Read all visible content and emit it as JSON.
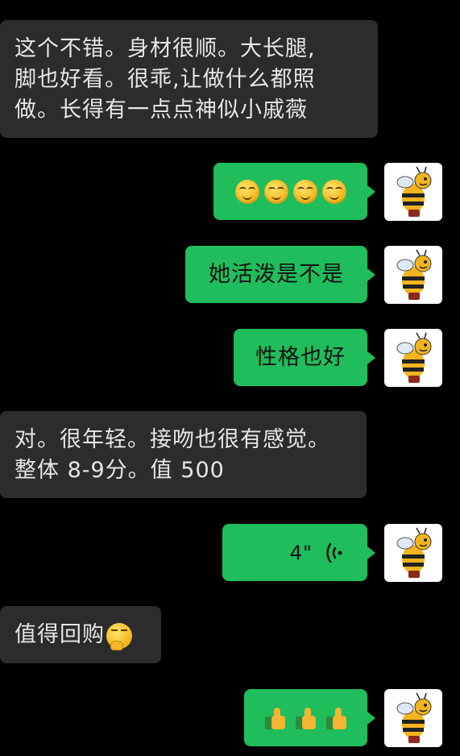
{
  "colors": {
    "background": "#000000",
    "incoming_bubble": "#2c2c2c",
    "outgoing_bubble": "#1fbd5b",
    "incoming_text": "#e6e6e6"
  },
  "messages": [
    {
      "side": "incoming",
      "lines": [
        "这个不错。身材很顺。大长腿,",
        "脚也好看。很乖,让做什么都照",
        "做。长得有一点点神似小戚薇"
      ]
    },
    {
      "side": "outgoing",
      "type": "emoji",
      "emojis": [
        "smirk-face-emoji",
        "smirk-face-emoji",
        "smirk-face-emoji",
        "smirk-face-emoji"
      ]
    },
    {
      "side": "outgoing",
      "text": "她活泼是不是"
    },
    {
      "side": "outgoing",
      "text": "性格也好"
    },
    {
      "side": "incoming",
      "lines": [
        "对。很年轻。接吻也很有感觉。",
        "整体 8-9分。值 500"
      ]
    },
    {
      "side": "outgoing",
      "type": "voice",
      "duration": "4\""
    },
    {
      "side": "incoming",
      "text": "值得回购",
      "trailing_emoji": "thinking-face-emoji"
    },
    {
      "side": "outgoing",
      "type": "emoji",
      "emojis": [
        "thumbs-up-emoji",
        "thumbs-up-emoji",
        "thumbs-up-emoji"
      ]
    }
  ],
  "avatar": {
    "icon": "bee-mascot-avatar"
  }
}
